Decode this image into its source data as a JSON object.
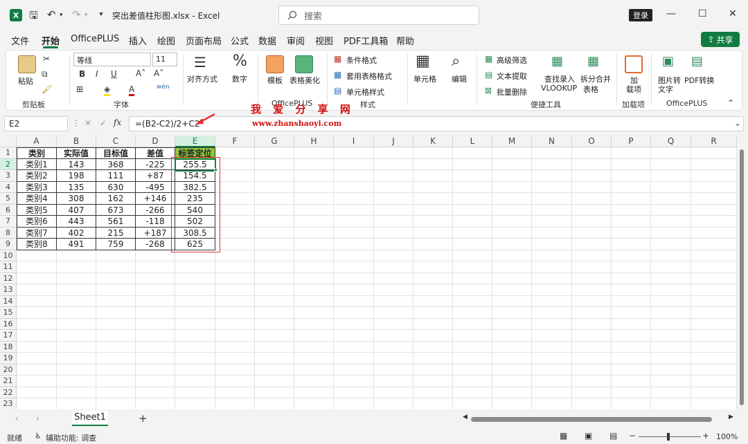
{
  "title_bar": {
    "file_title": "突出差值柱形图.xlsx  -  Excel",
    "search_placeholder": "搜索",
    "login_label": "登录"
  },
  "menu": {
    "items": [
      "文件",
      "开始",
      "OfficePLUS",
      "插入",
      "绘图",
      "页面布局",
      "公式",
      "数据",
      "审阅",
      "视图",
      "PDF工具箱",
      "帮助"
    ],
    "active": "开始",
    "share_label": "共享"
  },
  "ribbon": {
    "paste_label": "粘贴",
    "clipboard_group": "剪贴板",
    "font_name": "等线",
    "font_size": "11",
    "font_group": "字体",
    "align_label": "对齐方式",
    "number_label": "数字",
    "template_label": "模板",
    "beautify_label": "表格美化",
    "officeplus_group_mid": "OfficePLUS",
    "cond_format": "条件格式",
    "table_format": "套用表格格式",
    "cell_style": "单元格样式",
    "style_group": "样式",
    "cells_label": "单元格",
    "edit_label": "编辑",
    "adv_filter": "高级筛选",
    "text_extract": "文本提取",
    "batch_delete": "批量删除",
    "lookup_label_1": "查找录入",
    "lookup_label_2": "VLOOKUP",
    "split_label_1": "拆分合并",
    "split_label_2": "表格",
    "quick_tools_group": "便捷工具",
    "addin_label_1": "加",
    "addin_label_2": "载项",
    "addin_group": "加载项",
    "img2text_1": "图片转",
    "img2text_2": "文字",
    "pdf_convert": "PDF转换",
    "officeplus_group": "OfficePLUS"
  },
  "formula_bar": {
    "name_box": "E2",
    "fx_label": "fx",
    "formula": "=(B2-C2)/2+C2"
  },
  "watermark": {
    "line1": "我 爱 分 享 网",
    "line2": "www.zhanshaoyi.com"
  },
  "columns": [
    "A",
    "B",
    "C",
    "D",
    "E",
    "F",
    "G",
    "H",
    "I",
    "J",
    "K",
    "L",
    "M",
    "N",
    "O",
    "P",
    "Q",
    "R"
  ],
  "row_numbers": [
    "1",
    "2",
    "3",
    "4",
    "5",
    "6",
    "7",
    "8",
    "9",
    "10",
    "11",
    "12",
    "13",
    "14",
    "15",
    "16",
    "17",
    "18",
    "19",
    "20",
    "21",
    "22",
    "23"
  ],
  "table": {
    "headers": [
      "类别",
      "实际值",
      "目标值",
      "差值",
      "标签定位"
    ],
    "rows": [
      [
        "类别1",
        "143",
        "368",
        "-225",
        "255.5"
      ],
      [
        "类别2",
        "198",
        "111",
        "+87",
        "154.5"
      ],
      [
        "类别3",
        "135",
        "630",
        "-495",
        "382.5"
      ],
      [
        "类别4",
        "308",
        "162",
        "+146",
        "235"
      ],
      [
        "类别5",
        "407",
        "673",
        "-266",
        "540"
      ],
      [
        "类别6",
        "443",
        "561",
        "-118",
        "502"
      ],
      [
        "类别7",
        "402",
        "215",
        "+187",
        "308.5"
      ],
      [
        "类别8",
        "491",
        "759",
        "-268",
        "625"
      ]
    ]
  },
  "sheets": [
    "Sheet1"
  ],
  "status": {
    "ready": "就绪",
    "accessibility": "辅助功能: 调查",
    "zoom": "100%"
  },
  "colors": {
    "excel_green": "#107c41",
    "header_fill": "#8fc43f",
    "highlight_red": "#e03030"
  }
}
